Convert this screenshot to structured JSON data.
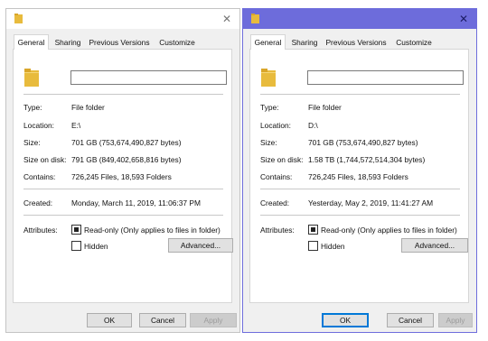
{
  "tabs": [
    "General",
    "Sharing",
    "Previous Versions",
    "Customize"
  ],
  "labels": {
    "type": "Type:",
    "location": "Location:",
    "size": "Size:",
    "size_on_disk": "Size on disk:",
    "contains": "Contains:",
    "created": "Created:",
    "attributes": "Attributes:"
  },
  "checkboxes": {
    "readonly": "Read-only (Only applies to files in folder)",
    "hidden": "Hidden"
  },
  "buttons": {
    "advanced": "Advanced...",
    "ok": "OK",
    "cancel": "Cancel",
    "apply": "Apply"
  },
  "icons": {
    "folder": "folder-icon",
    "close": "close-icon"
  },
  "colors": {
    "active_titlebar": "#6d6cdb",
    "folder": "#e8bb3d"
  },
  "dialogs": [
    {
      "name_value": "",
      "type": "File folder",
      "location": "E:\\",
      "size": "701 GB (753,674,490,827 bytes)",
      "size_on_disk": "791 GB (849,402,658,816 bytes)",
      "contains": "726,245 Files, 18,593 Folders",
      "created": "Monday, March 11, 2019, 11:06:37 PM",
      "readonly_state": "indeterminate",
      "hidden_checked": false,
      "active": false
    },
    {
      "name_value": "",
      "type": "File folder",
      "location": "D:\\",
      "size": "701 GB (753,674,490,827 bytes)",
      "size_on_disk": "1.58 TB (1,744,572,514,304 bytes)",
      "contains": "726,245 Files, 18,593 Folders",
      "created": "Yesterday, May 2, 2019, 11:41:27 AM",
      "readonly_state": "indeterminate",
      "hidden_checked": false,
      "active": true
    }
  ]
}
